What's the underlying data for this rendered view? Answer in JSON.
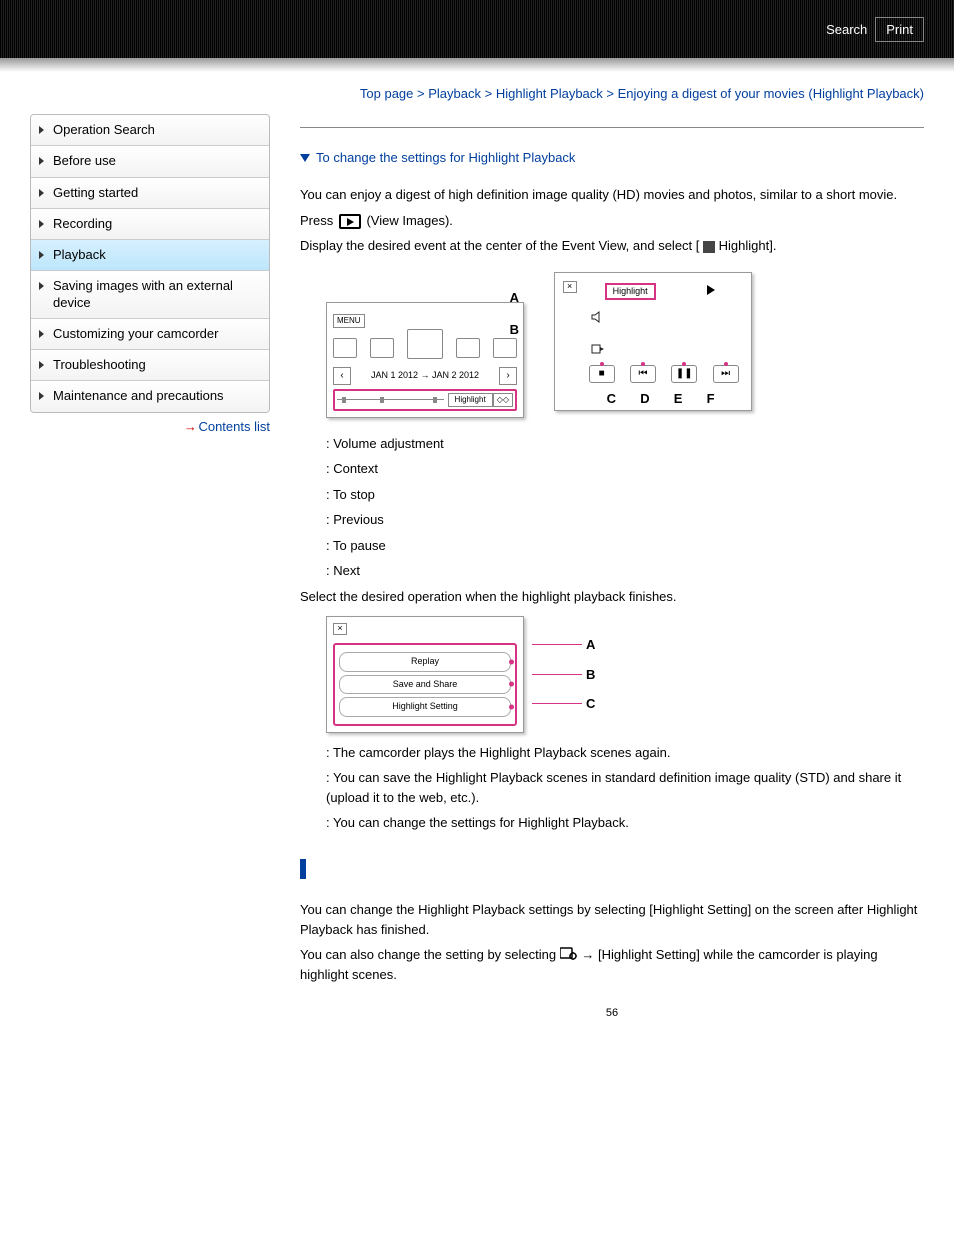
{
  "header": {
    "search": "Search",
    "print": "Print"
  },
  "sidebar": {
    "items": [
      {
        "label": "Operation Search"
      },
      {
        "label": "Before use"
      },
      {
        "label": "Getting started"
      },
      {
        "label": "Recording"
      },
      {
        "label": "Playback",
        "active": true
      },
      {
        "label": "Saving images with an external device"
      },
      {
        "label": "Customizing your camcorder"
      },
      {
        "label": "Troubleshooting"
      },
      {
        "label": "Maintenance and precautions"
      }
    ],
    "contents_link": "Contents list"
  },
  "breadcrumbs": {
    "items": [
      "Top page",
      "Playback",
      "Highlight Playback",
      "Enjoying a digest of your movies (Highlight Playback)"
    ],
    "sep": ">"
  },
  "toc": {
    "link1": "To change the settings for Highlight Playback"
  },
  "body": {
    "intro": "You can enjoy a digest of high definition image quality (HD) movies and photos, similar to a short movie.",
    "step1_a": "Press ",
    "step1_b": " (View Images).",
    "step2_a": "Display the desired event at the center of the Event View, and select [",
    "step2_b": "Highlight].",
    "fig_event": {
      "menu": "MENU",
      "date": "JAN 1 2012 → JAN 2 2012",
      "highlight": "Highlight"
    },
    "fig_play": {
      "highlight": "Highlight",
      "labels_left": [
        "A",
        "B"
      ],
      "labels_bottom": [
        "C",
        "D",
        "E",
        "F"
      ]
    },
    "list1": [
      ": Volume adjustment",
      ": Context",
      ": To stop",
      ": Previous",
      ": To pause",
      ": Next"
    ],
    "step3": "Select the desired operation when the highlight playback finishes.",
    "fig_menu": {
      "rows": [
        "Replay",
        "Save and Share",
        "Highlight Setting"
      ],
      "labels": [
        "A",
        "B",
        "C"
      ]
    },
    "list2": [
      ": The camcorder plays the Highlight Playback scenes again.",
      ": You can save the Highlight Playback scenes in standard definition image quality (STD) and share it (upload it to the web, etc.).",
      ": You can change the settings for Highlight Playback."
    ],
    "sec2_p1": "You can change the Highlight Playback settings by selecting [Highlight Setting] on the screen after Highlight Playback has finished.",
    "sec2_p2_a": "You can also change the setting by selecting ",
    "sec2_p2_b": " [Highlight Setting] while the camcorder is playing highlight scenes."
  },
  "pagenum": "56"
}
